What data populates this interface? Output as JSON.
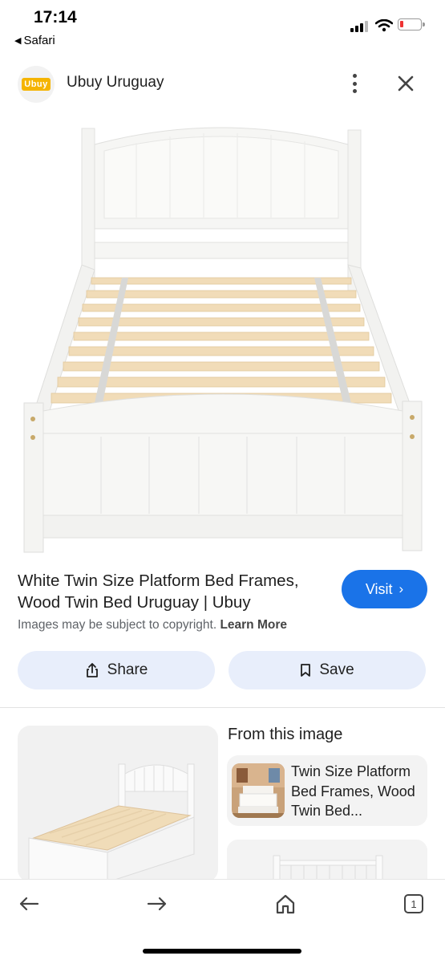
{
  "status_bar": {
    "time": "17:14",
    "back_app": "Safari",
    "battery_color": "#e33333"
  },
  "header": {
    "logo_text": "Ubuy",
    "site_name": "Ubuy Uruguay",
    "menu_icon": "more-vert-icon",
    "close_icon": "close-icon"
  },
  "hero": {
    "image": "white-twin-bed-frame-photo"
  },
  "result": {
    "title": "White Twin Size Platform Bed Frames, Wood Twin Bed Uruguay | Ubuy",
    "visit_label": "Visit",
    "copyright_text": "Images may be subject to copyright.",
    "learn_more": "Learn More",
    "share_label": "Share",
    "save_label": "Save"
  },
  "related": {
    "heading": "From this image",
    "cards": [
      {
        "title": "Twin Size Platform Bed Frames, Wood Twin Bed..."
      }
    ]
  },
  "bottom_nav": {
    "back_icon": "arrow-left-icon",
    "forward_icon": "arrow-right-icon",
    "home_icon": "home-icon",
    "tab_count": "1"
  },
  "colors": {
    "accent": "#1a73e8",
    "pill_bg": "#e8eefb"
  }
}
